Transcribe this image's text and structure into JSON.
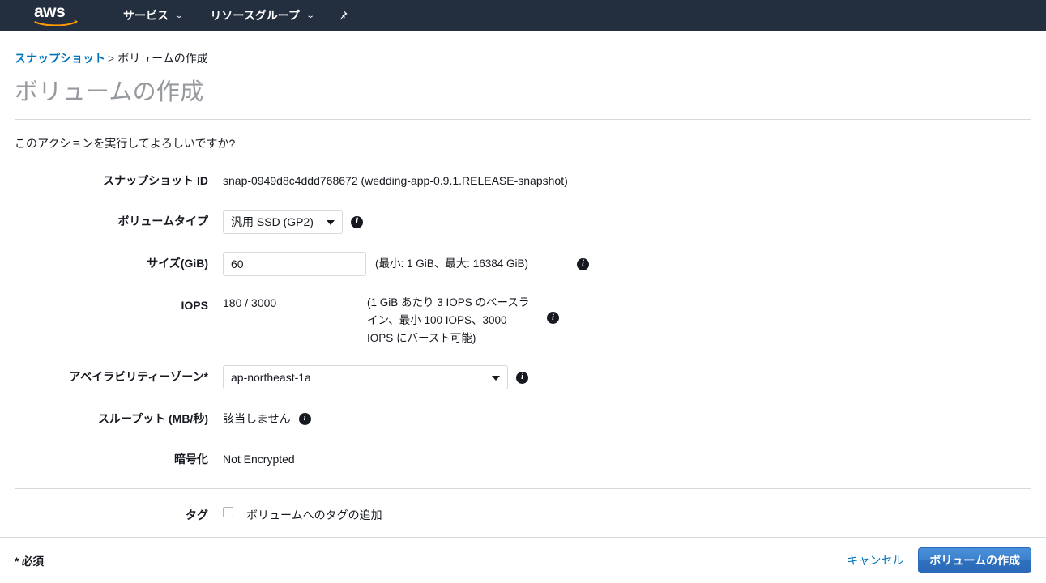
{
  "topnav": {
    "logo_text": "aws",
    "items": [
      {
        "label": "サービス",
        "caret": "⌄"
      },
      {
        "label": "リソースグループ",
        "caret": "⌄"
      }
    ],
    "pin_icon": "pushpin-icon"
  },
  "breadcrumb": {
    "parent": "スナップショット",
    "separator": ">",
    "current": "ボリュームの作成"
  },
  "page": {
    "title": "ボリュームの作成",
    "confirm_text": "このアクションを実行してよろしいですか?"
  },
  "form": {
    "snapshot_id": {
      "label": "スナップショット ID",
      "value": "snap-0949d8c4ddd768672 (wedding-app-0.9.1.RELEASE-snapshot)"
    },
    "volume_type": {
      "label": "ボリュームタイプ",
      "value": "汎用 SSD (GP2)",
      "info_icon": "info-icon"
    },
    "size": {
      "label": "サイズ(GiB)",
      "value": "60",
      "hint": "(最小: 1 GiB、最大: 16384 GiB)",
      "info_icon": "info-icon"
    },
    "iops": {
      "label": "IOPS",
      "value": "180 / 3000",
      "hint": "(1 GiB あたり 3 IOPS のベースライン、最小 100 IOPS、3000 IOPS にバースト可能)",
      "info_icon": "info-icon"
    },
    "availability_zone": {
      "label": "アベイラビリティーゾーン*",
      "value": "ap-northeast-1a",
      "info_icon": "info-icon"
    },
    "throughput": {
      "label": "スループット (MB/秒)",
      "value": "該当しません",
      "info_icon": "info-icon"
    },
    "encryption": {
      "label": "暗号化",
      "value": "Not Encrypted"
    },
    "tags": {
      "label": "タグ",
      "checkbox_label": "ボリュームへのタグの追加",
      "checked": false
    }
  },
  "footer": {
    "required_note": "* 必須",
    "cancel_label": "キャンセル",
    "submit_label": "ボリュームの作成"
  },
  "colors": {
    "nav_background": "#232f3e",
    "link_blue": "#0073bb",
    "primary_button": "#2f71bf",
    "logo_orange": "#ff9900",
    "title_gray": "#96999e",
    "divider": "#d5dbdb"
  }
}
